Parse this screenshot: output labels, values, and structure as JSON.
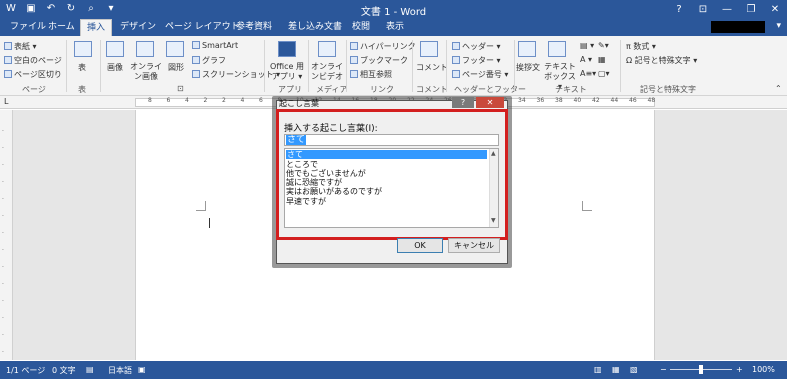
{
  "titlebar": {
    "title": "文書 1 - Word",
    "qat": [
      "save-icon",
      "undo-icon",
      "redo-icon",
      "print-preview-icon"
    ],
    "help": "?",
    "minimize": "—",
    "restore": "❐",
    "close": "✕"
  },
  "tabs": [
    "ファイル",
    "ホーム",
    "挿入",
    "デザイン",
    "ページ レイアウト",
    "参考資料",
    "差し込み文書",
    "校閲",
    "表示"
  ],
  "active_tab": "挿入",
  "ribbon": {
    "pages": {
      "cover": "表紙 ▾",
      "blank": "空白のページ",
      "break": "ページ区切り",
      "label": "ページ"
    },
    "table": {
      "button": "表",
      "label": "表"
    },
    "illustrations": {
      "picture": "画像",
      "online_picture": "オンライン画像",
      "shapes": "図形",
      "smartart": "SmartArt",
      "chart": "グラフ",
      "screenshot": "スクリーンショット ▾"
    },
    "apps": {
      "office_apps": "Office 用アプリ ▾",
      "label": "アプリ"
    },
    "media": {
      "online_video": "オンラインビデオ",
      "label": "メディア"
    },
    "links": {
      "hyperlink": "ハイパーリンク",
      "bookmark": "ブックマーク",
      "cross_ref": "相互参照",
      "label": "リンク"
    },
    "comments": {
      "comment": "コメント",
      "label": "コメント"
    },
    "header_footer": {
      "header": "ヘッダー ▾",
      "footer": "フッター ▾",
      "page_number": "ページ番号 ▾",
      "label": "ヘッダーとフッター"
    },
    "text": {
      "greeting": "挨拶文",
      "textbox": "テキストボックス ▾",
      "label": "テキスト"
    },
    "symbols": {
      "equation": "π 数式 ▾",
      "symbol": "Ω 記号と特殊文字 ▾",
      "label": "記号と特殊文字"
    }
  },
  "ruler": {
    "numbers": [
      "8",
      "6",
      "4",
      "2",
      "2",
      "4",
      "6",
      "8",
      "10",
      "12",
      "14",
      "16",
      "18",
      "20",
      "22",
      "24",
      "26",
      "28",
      "30",
      "32",
      "34",
      "36",
      "38",
      "40",
      "42",
      "44",
      "46",
      "48"
    ]
  },
  "dialog": {
    "title": "起こし言葉",
    "help": "?",
    "close": "✕",
    "label": "挿入する起こし言葉(I):",
    "input_value": "さて",
    "list": [
      "さて",
      "ところで",
      "他でもございませんが",
      "誠に恐縮ですが",
      "実はお願いがあるのですが",
      "早速ですが"
    ],
    "selected_index": 0,
    "ok": "OK",
    "cancel": "キャンセル"
  },
  "status": {
    "page": "1/1 ページ",
    "words": "0 文字",
    "language": "日本語",
    "zoom": "100%",
    "zoom_minus": "−",
    "zoom_plus": "+"
  }
}
